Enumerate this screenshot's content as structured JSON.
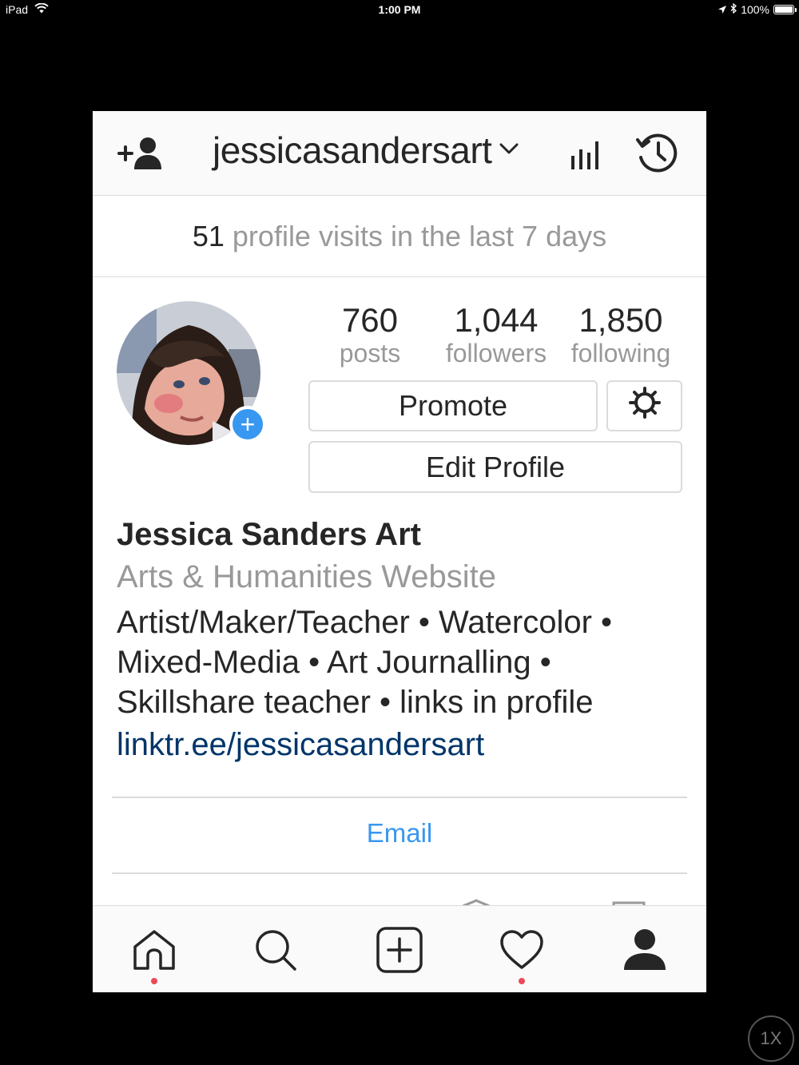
{
  "status_bar": {
    "device": "iPad",
    "time": "1:00 PM",
    "battery": "100%",
    "battery_level": 1.0
  },
  "header": {
    "username": "jessicasandersart",
    "icons": [
      "add-person-icon",
      "chevron-down-icon",
      "insights-icon",
      "archive-icon"
    ]
  },
  "visits": {
    "count": "51",
    "text": "profile visits in the last 7 days"
  },
  "stats": {
    "posts": {
      "value": "760",
      "label": "posts"
    },
    "followers": {
      "value": "1,044",
      "label": "followers"
    },
    "following": {
      "value": "1,850",
      "label": "following"
    }
  },
  "buttons": {
    "promote": "Promote",
    "edit_profile": "Edit Profile"
  },
  "bio": {
    "name": "Jessica Sanders Art",
    "category": "Arts & Humanities Website",
    "line1": "Artist/Maker/Teacher • Watercolor •",
    "line2": "Mixed-Media • Art Journalling •",
    "line3": "Skillshare teacher • links in profile",
    "link": "linktr.ee/jessicasandersart"
  },
  "contact": {
    "email_label": "Email"
  },
  "bottom_nav": {
    "items": [
      "home-icon",
      "search-icon",
      "new-post-icon",
      "activity-icon",
      "profile-icon"
    ],
    "notification_dots": [
      "home",
      "activity"
    ]
  },
  "colors": {
    "accent_blue": "#3897f0",
    "link_navy": "#003569",
    "notification_red": "#ed4956",
    "muted_gray": "#999999"
  },
  "zoom_badge": "1X"
}
